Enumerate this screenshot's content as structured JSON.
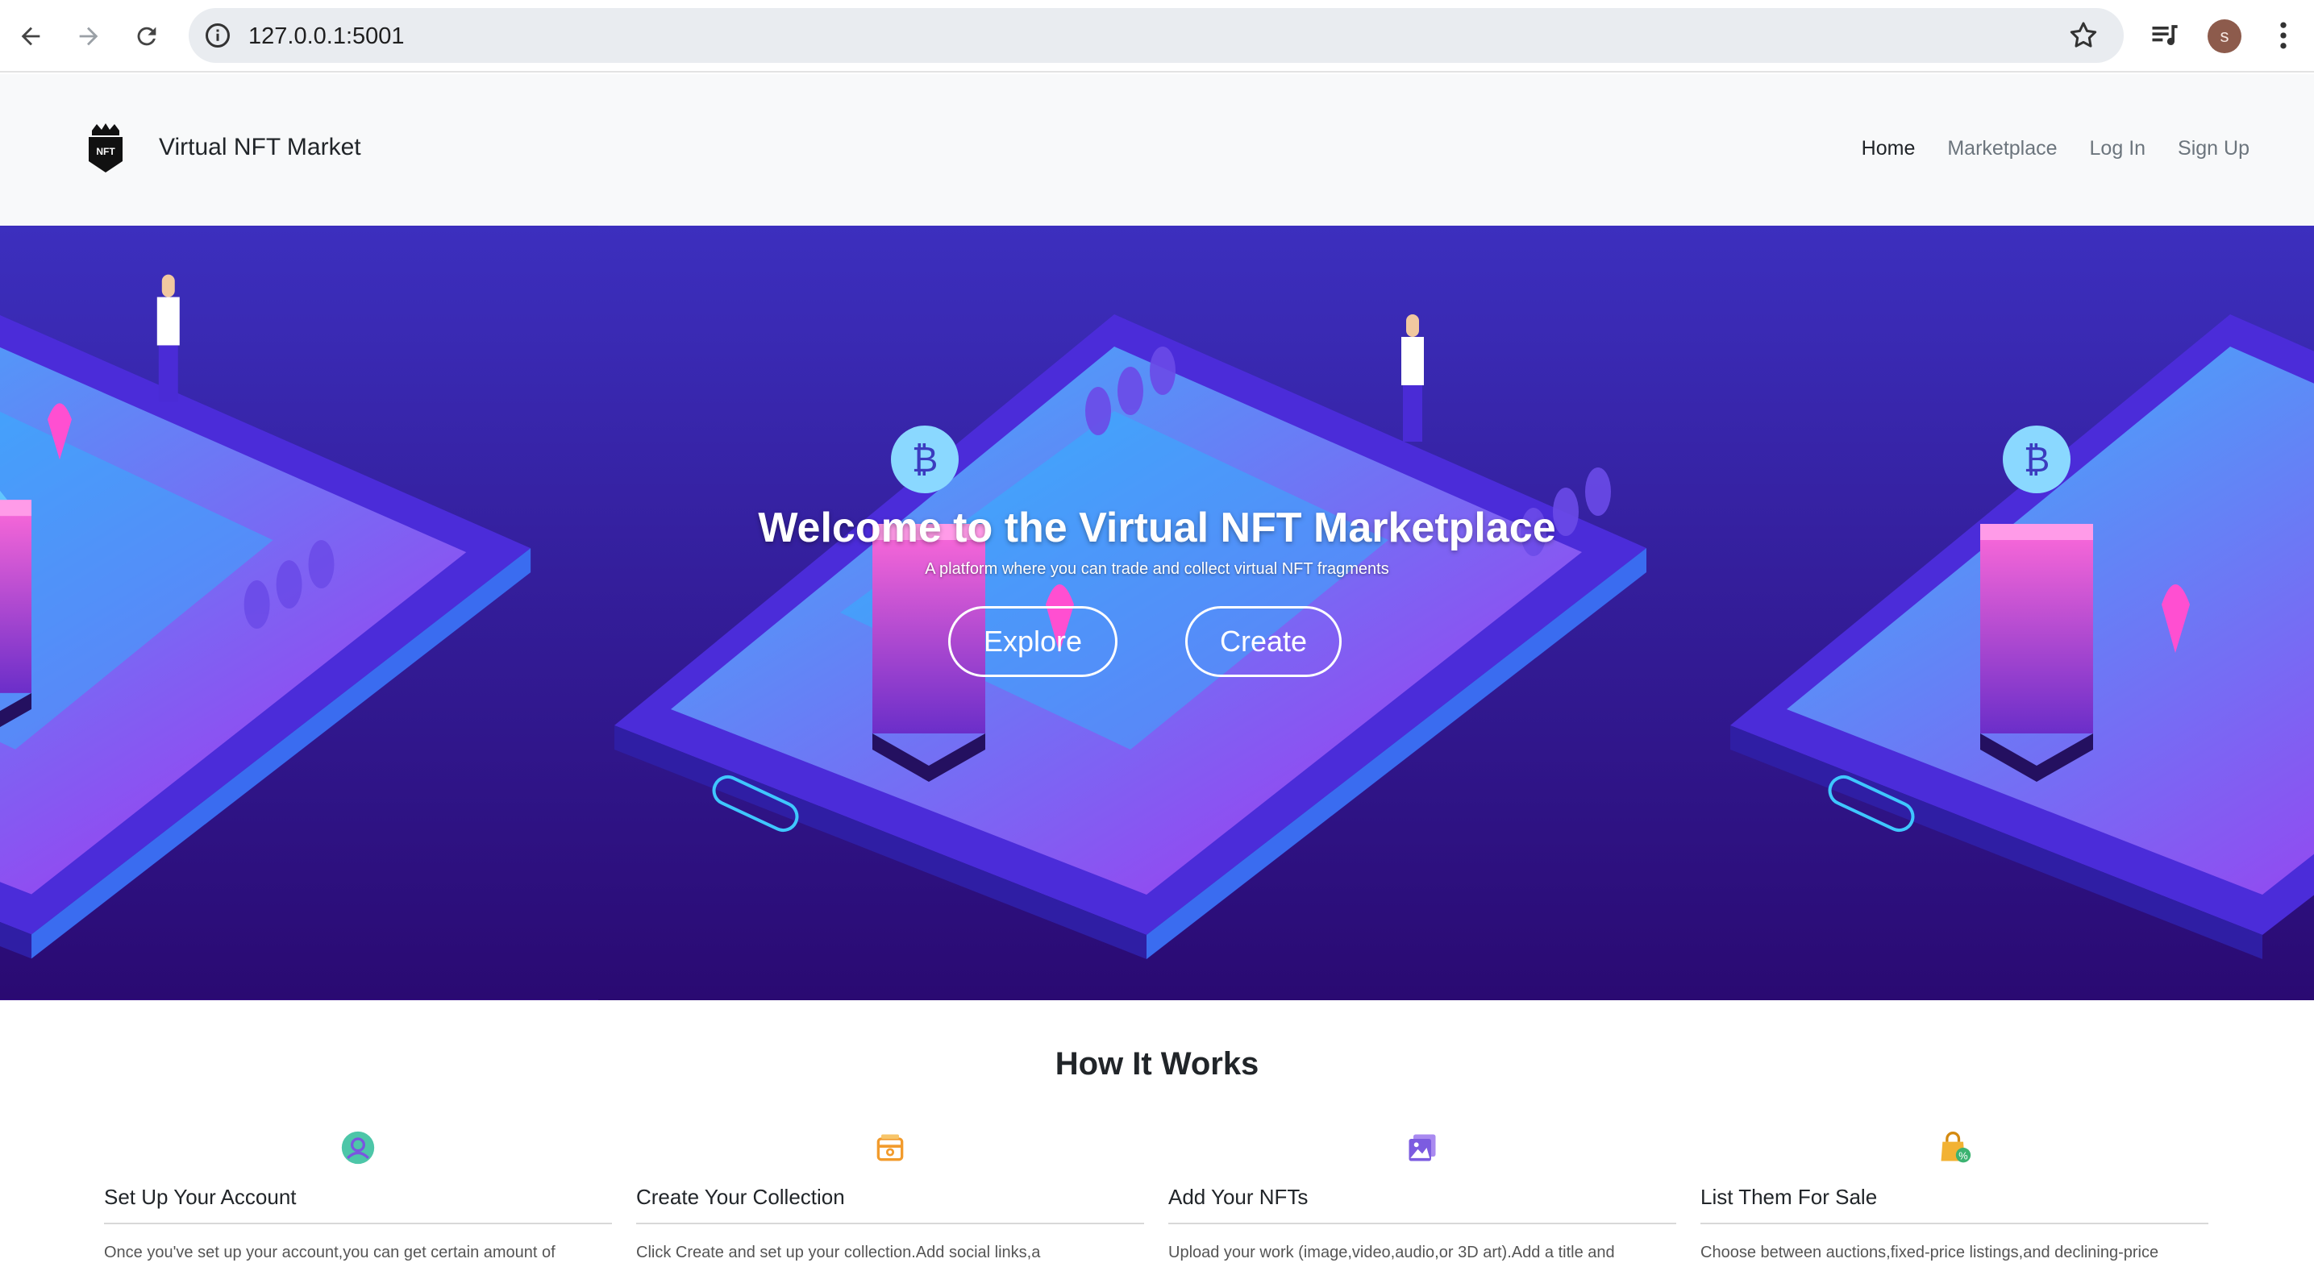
{
  "browser": {
    "url": "127.0.0.1:5001",
    "profile_initial": "s",
    "icons": [
      "back-arrow-icon",
      "forward-arrow-icon",
      "reload-icon",
      "site-info-icon",
      "bookmark-star-icon",
      "media-controls-icon",
      "kebab-menu-icon"
    ]
  },
  "header": {
    "brand": "Virtual NFT Market",
    "logo_text": "NFT",
    "nav": [
      {
        "label": "Home",
        "active": true
      },
      {
        "label": "Marketplace",
        "active": false
      },
      {
        "label": "Log In",
        "active": false
      },
      {
        "label": "Sign Up",
        "active": false
      }
    ]
  },
  "hero": {
    "title": "Welcome to the Virtual NFT Marketplace",
    "subtitle": "A platform where you can trade and collect virtual NFT fragments",
    "explore_label": "Explore",
    "create_label": "Create"
  },
  "how_it_works": {
    "title": "How It Works",
    "steps": [
      {
        "title": "Set Up Your Account",
        "text": "Once you've set up your account,you can get certain amount of",
        "icon": "user-profile-icon"
      },
      {
        "title": "Create Your Collection",
        "text": "Click Create and set up your collection.Add social links,a",
        "icon": "wallet-collection-icon"
      },
      {
        "title": "Add Your NFTs",
        "text": "Upload your work (image,video,audio,or 3D art).Add a title and",
        "icon": "image-gallery-icon"
      },
      {
        "title": "List Them For Sale",
        "text": "Choose between auctions,fixed-price listings,and declining-price",
        "icon": "shopping-bag-icon"
      }
    ]
  },
  "colors": {
    "hero_top": "#3a2bb5",
    "hero_bottom": "#3b0f8e",
    "accent_cyan": "#3fc7ff",
    "accent_pink": "#ff3fd0"
  }
}
